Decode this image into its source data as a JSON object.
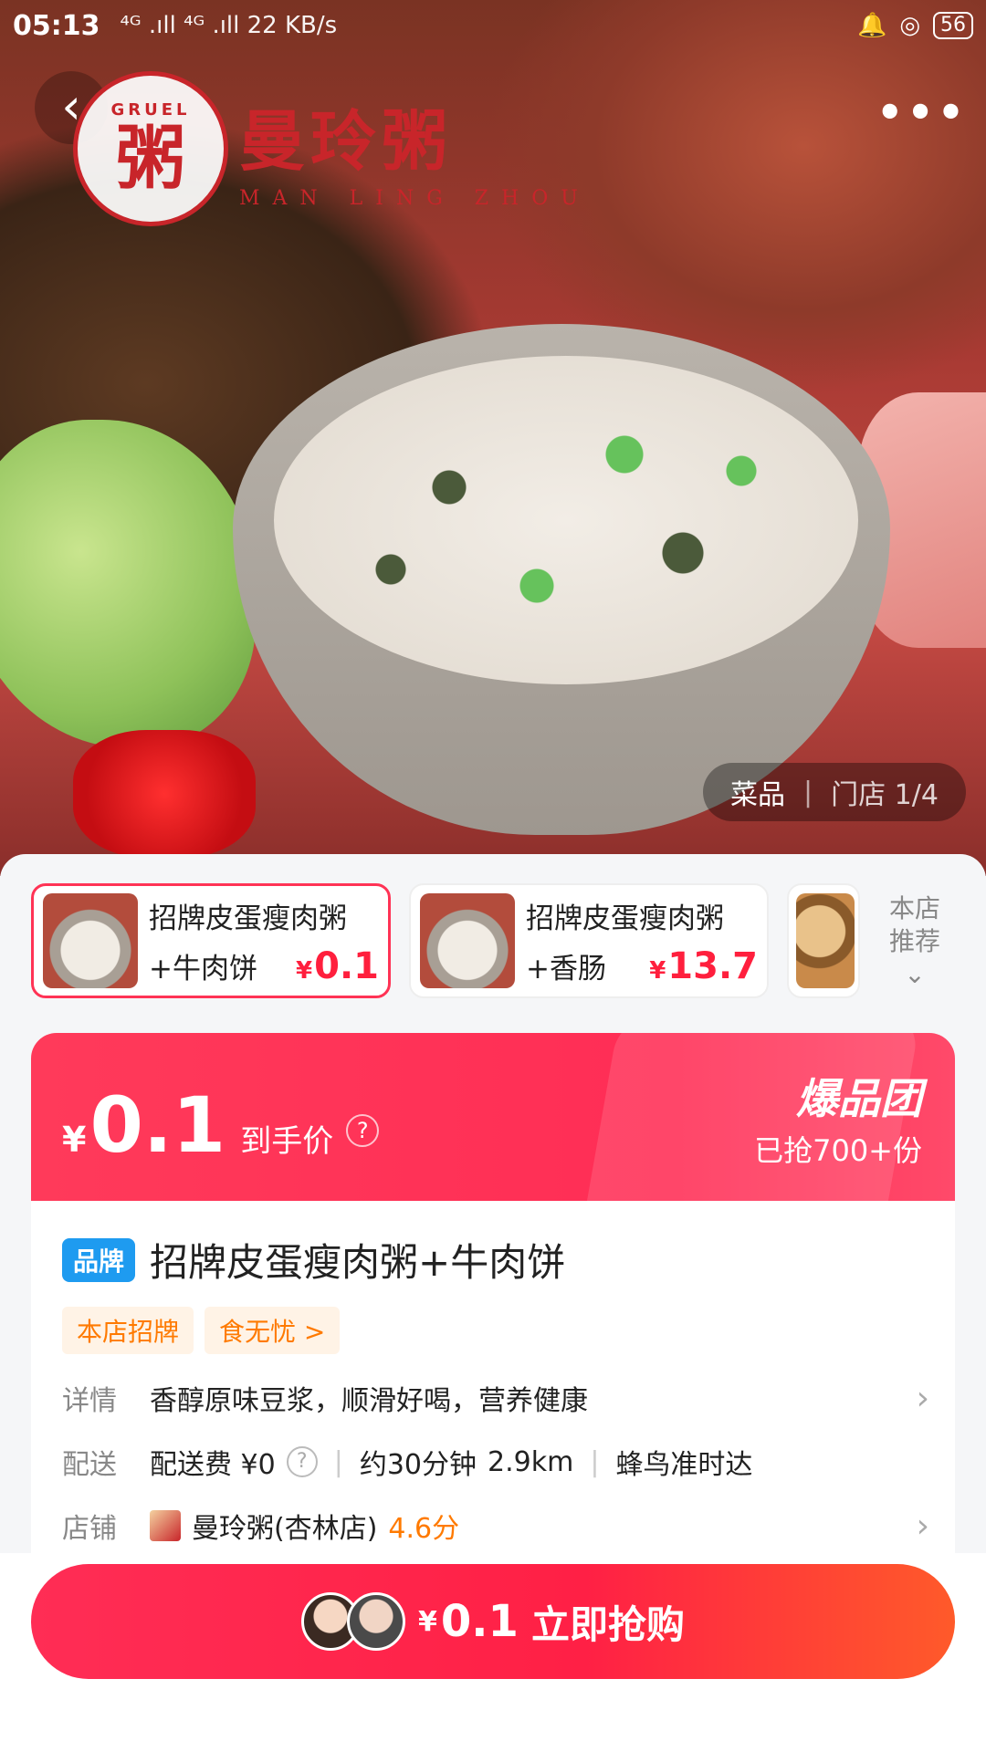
{
  "status_bar": {
    "time": "05:13",
    "network": "⁴ᴳ .ıll ⁴ᴳ .ıll 22 KB/s",
    "battery": "56"
  },
  "hero": {
    "logo_seal_en": "GRUEL",
    "logo_seal_ch": "粥",
    "brand_name": "曼玲粥",
    "brand_pinyin": "MAN LING ZHOU",
    "gallery_tab_dish": "菜品",
    "gallery_tab_store": "门店 1/4"
  },
  "combos": [
    {
      "line1": "招牌皮蛋瘦肉粥",
      "line2": "+牛肉饼",
      "yen": "¥",
      "price": "0.1",
      "selected": true
    },
    {
      "line1": "招牌皮蛋瘦肉粥",
      "line2": "+香肠",
      "yen": "¥",
      "price": "13.7",
      "selected": false
    }
  ],
  "recommend": {
    "line1": "本店",
    "line2": "推荐"
  },
  "promo": {
    "yen": "¥",
    "price": "0.1",
    "label": "到手价",
    "badge": "爆品团",
    "sold": "已抢700+份"
  },
  "product": {
    "brand_tag": "品牌",
    "title": "招牌皮蛋瘦肉粥+牛肉饼",
    "tags": [
      "本店招牌",
      "食无忧 >"
    ],
    "detail_key": "详情",
    "detail_val": "香醇原味豆浆，顺滑好喝，营养健康",
    "delivery_key": "配送",
    "delivery_fee": "配送费 ¥0",
    "delivery_time": "约30分钟",
    "delivery_distance": "2.9km",
    "delivery_rider": "蜂鸟准时达",
    "shop_key": "店铺",
    "shop_name": "曼玲粥(杏林店)",
    "shop_rating": "4.6分"
  },
  "buy": {
    "yen": "¥",
    "price": "0.1",
    "cta": "立即抢购"
  },
  "colors": {
    "accent": "#ff2d55",
    "price_red": "#ff1f3d",
    "brand_blue": "#1e9bf0",
    "tag_orange": "#ff7a00"
  }
}
